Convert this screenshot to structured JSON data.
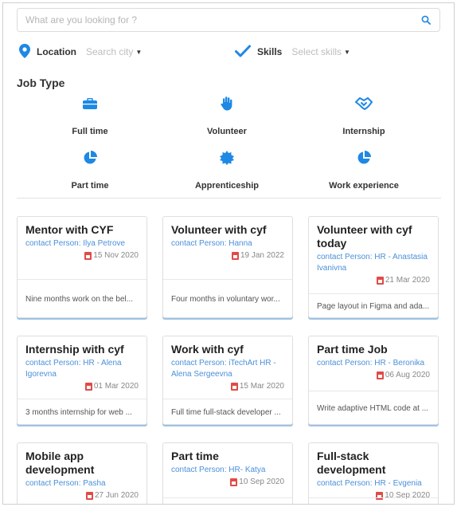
{
  "search": {
    "placeholder": "What are you looking for ?"
  },
  "filters": {
    "location": {
      "label": "Location",
      "placeholder": "Search city"
    },
    "skills": {
      "label": "Skills",
      "placeholder": "Select skills"
    }
  },
  "job_type": {
    "title": "Job Type",
    "items": [
      {
        "label": "Full time",
        "icon": "briefcase-icon"
      },
      {
        "label": "Volunteer",
        "icon": "hand-icon"
      },
      {
        "label": "Internship",
        "icon": "handshake-icon"
      },
      {
        "label": "Part time",
        "icon": "pie-chart-icon"
      },
      {
        "label": "Apprenticeship",
        "icon": "badge-icon"
      },
      {
        "label": "Work experience",
        "icon": "pie-chart-icon"
      }
    ]
  },
  "jobs": [
    {
      "title": "Mentor with CYF",
      "contact": "contact Person: Ilya Petrove",
      "date": "15 Nov 2020",
      "description": "Nine months work on the bel..."
    },
    {
      "title": "Volunteer with cyf",
      "contact": "contact Person: Hanna",
      "date": "19 Jan 2022",
      "description": "Four months in voluntary wor..."
    },
    {
      "title": "Volunteer with cyf today",
      "contact": "contact Person: HR - Anastasia Ivanivna",
      "date": "21 Mar 2020",
      "description": "Page layout in Figma and ada..."
    },
    {
      "title": "Internship with cyf",
      "contact": "contact Person: HR - Alena Igorevna",
      "date": "01 Mar 2020",
      "description": "3 months internship for web ..."
    },
    {
      "title": "Work with cyf",
      "contact": "contact Person: iTechArt HR - Alena Sergeevna",
      "date": "15 Mar 2020",
      "description": "Full time full-stack developer ..."
    },
    {
      "title": "Part time Job",
      "contact": "contact Person: HR - Beronika",
      "date": "06 Aug 2020",
      "description": "Write adaptive HTML code at ..."
    },
    {
      "title": "Mobile app development",
      "contact": "contact Person: Pasha",
      "date": "27 Jun 2020",
      "description": ""
    },
    {
      "title": "Part time",
      "contact": "contact Person: HR- Katya",
      "date": "10 Sep 2020",
      "description": ""
    },
    {
      "title": "Full-stack development",
      "contact": "contact Person: HR - Evgenia",
      "date": "10 Sep 2020",
      "description": ""
    }
  ],
  "colors": {
    "accent": "#1e88e5",
    "contact": "#4a90d9",
    "calendar": "#e14b47"
  }
}
